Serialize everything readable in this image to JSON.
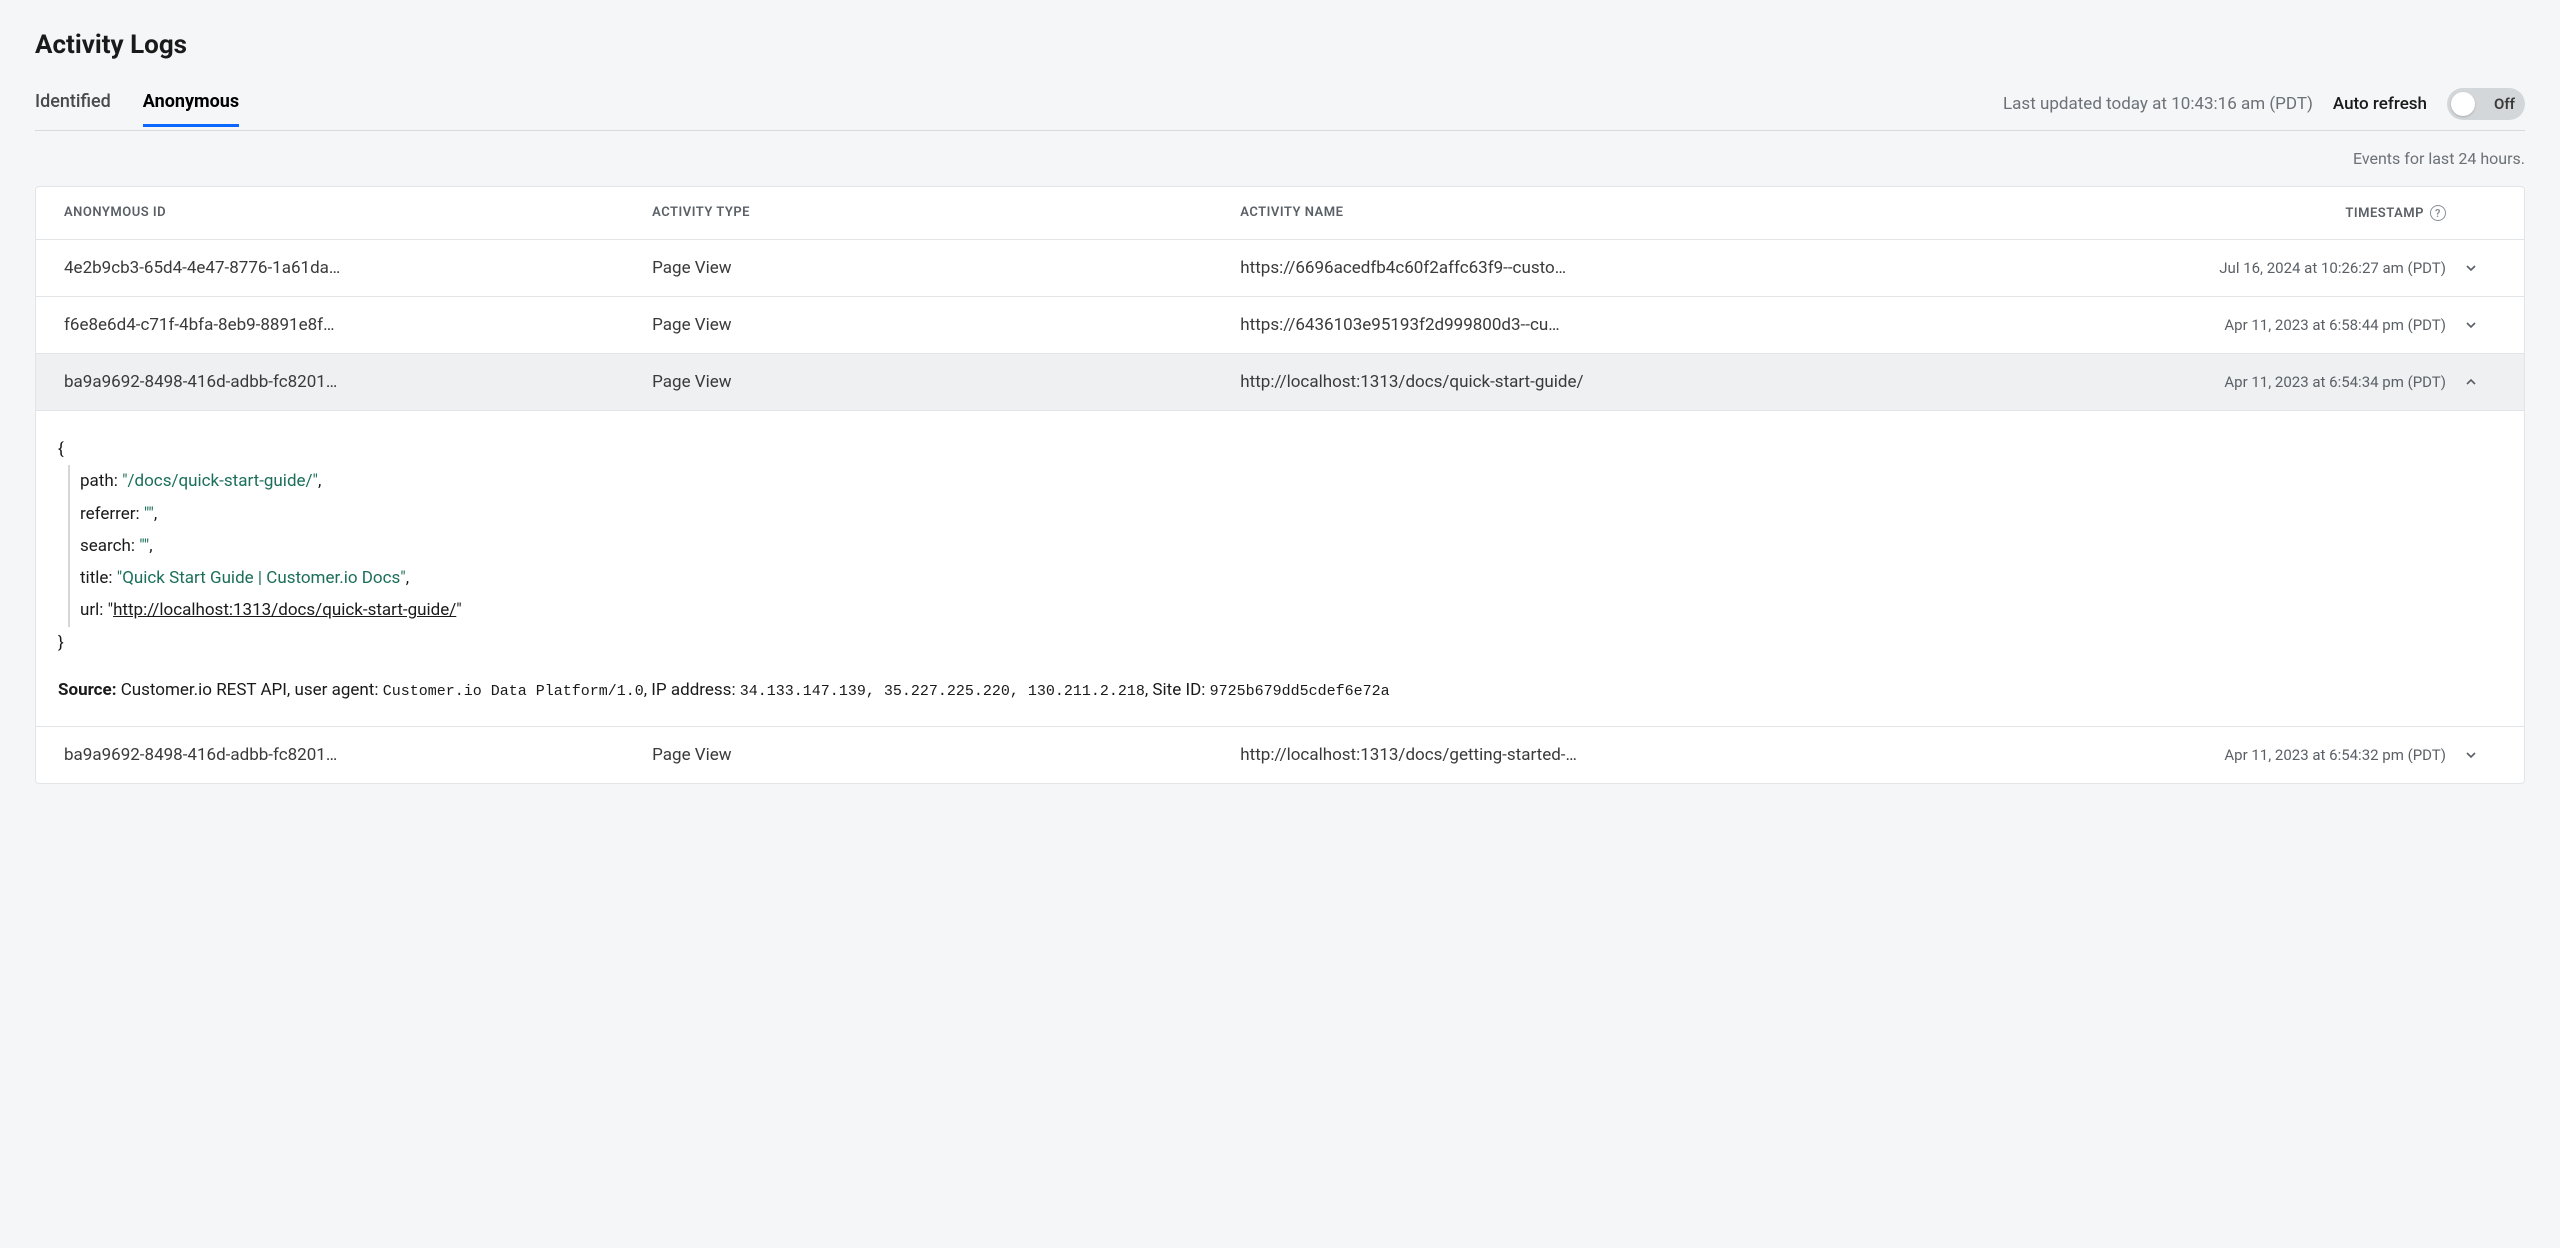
{
  "page_title": "Activity Logs",
  "tabs": {
    "identified": "Identified",
    "anonymous": "Anonymous"
  },
  "header": {
    "last_updated": "Last updated today at 10:43:16 am (PDT)",
    "auto_refresh_label": "Auto refresh",
    "toggle_state_label": "Off"
  },
  "events_range": "Events for last 24 hours.",
  "columns": {
    "anonymous_id": "ANONYMOUS ID",
    "activity_type": "ACTIVITY TYPE",
    "activity_name": "ACTIVITY NAME",
    "timestamp": "TIMESTAMP"
  },
  "rows": [
    {
      "id": "4e2b9cb3-65d4-4e47-8776-1a61da…",
      "type": "Page View",
      "name": "https://6696acedfb4c60f2affc63f9--custo…",
      "timestamp": "Jul 16, 2024 at 10:26:27 am (PDT)"
    },
    {
      "id": "f6e8e6d4-c71f-4bfa-8eb9-8891e8f…",
      "type": "Page View",
      "name": "https://6436103e95193f2d999800d3--cu…",
      "timestamp": "Apr 11, 2023 at 6:58:44 pm (PDT)"
    },
    {
      "id": "ba9a9692-8498-416d-adbb-fc8201…",
      "type": "Page View",
      "name": "http://localhost:1313/docs/quick-start-guide/",
      "timestamp": "Apr 11, 2023 at 6:54:34 pm (PDT)"
    },
    {
      "id": "ba9a9692-8498-416d-adbb-fc8201…",
      "type": "Page View",
      "name": "http://localhost:1313/docs/getting-started-…",
      "timestamp": "Apr 11, 2023 at 6:54:32 pm (PDT)"
    }
  ],
  "expanded_row_index": 2,
  "details": {
    "path_key": "path",
    "path_value": "\"/docs/quick-start-guide/\"",
    "referrer_key": "referrer",
    "referrer_value": "\"\"",
    "search_key": "search",
    "search_value": "\"\"",
    "title_key": "title",
    "title_value": "\"Quick Start Guide | Customer.io Docs\"",
    "url_key": "url",
    "url_value_display": "http://localhost:1313/docs/quick-start-guide/"
  },
  "source": {
    "label": "Source:",
    "api_text": " Customer.io REST API, user agent: ",
    "user_agent": "Customer.io Data Platform/1.0",
    "ip_label": ", IP address: ",
    "ip_value": "34.133.147.139, 35.227.225.220, 130.211.2.218",
    "site_label": ", Site ID: ",
    "site_value": "9725b679dd5cdef6e72a"
  }
}
